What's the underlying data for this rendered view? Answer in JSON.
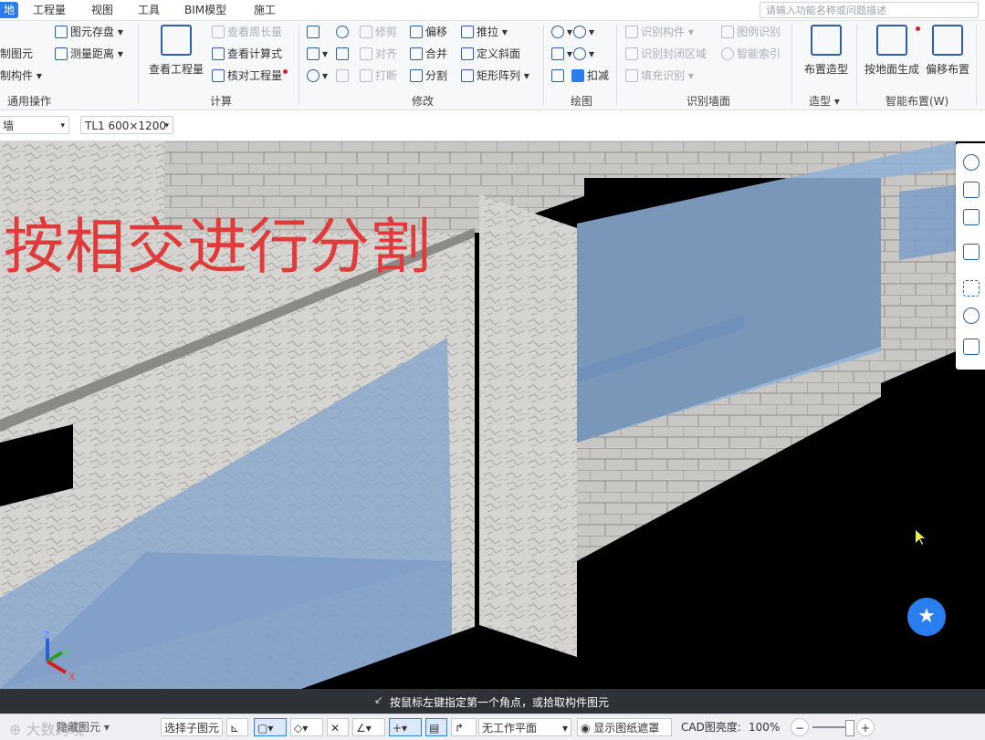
{
  "menu": {
    "tabs": [
      "地",
      "工程量",
      "视图",
      "工具",
      "BIM模型",
      "施工"
    ],
    "search_placeholder": "请输入功能名称或问题描述"
  },
  "ribbon": {
    "general": {
      "title": "通用操作",
      "items": [
        "图元存盘",
        "测量距离",
        "制图元",
        "制构件"
      ]
    },
    "calc": {
      "title": "计算",
      "big": "查看工程量",
      "items": [
        "查看周长量",
        "查看计算式",
        "核对工程量"
      ]
    },
    "modify": {
      "title": "修改",
      "col1": [
        "修剪",
        "对齐",
        "打断"
      ],
      "col2": [
        "偏移",
        "合并",
        "分割"
      ],
      "col3": [
        "推拉",
        "定义斜面",
        "矩形阵列"
      ]
    },
    "draw": {
      "title": "绘图",
      "items": [
        "扣减"
      ]
    },
    "wallid": {
      "title": "识别墙面",
      "col1": [
        "识别构件",
        "识别封闭区域",
        "填充识别"
      ],
      "col2": [
        "图例识别",
        "智能索引"
      ]
    },
    "shape": {
      "title": "造型",
      "big": "布置造型"
    },
    "smart": {
      "title": "智能布置(W)",
      "big1": "按地面生成",
      "big2": "偏移布置"
    }
  },
  "propbar": {
    "layer_value": "墙",
    "component_value": "TL1 600×1200"
  },
  "viewport": {
    "overlay_text": "按相交进行分割",
    "axis_labels": [
      "Z",
      "Y",
      "X"
    ]
  },
  "status": {
    "message": "按鼠标左键指定第一个角点，或拾取构件图元"
  },
  "bottombar": {
    "watermark": "大数跨境",
    "hide_label": "隐藏图元",
    "select_sub": "选择子图元",
    "work_plane": "无工作平面",
    "show_drawing": "显示图纸遮罩",
    "cad_brightness_label": "CAD图亮度:",
    "cad_brightness_value": "100%"
  },
  "colors": {
    "accent": "#2b7de9",
    "overlay_red": "#e03a3a",
    "glass": "#8fb0d8",
    "wall": "#d8d6d2"
  }
}
